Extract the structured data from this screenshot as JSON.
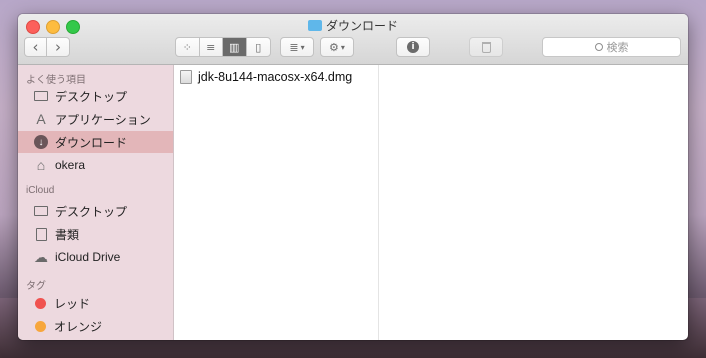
{
  "window": {
    "title": "ダウンロード"
  },
  "toolbar": {
    "back": "‹",
    "forward": "›",
    "view_icons": "⁘",
    "view_list": "≡",
    "view_columns": "▥",
    "view_gallery": "▯",
    "arrange": "≣",
    "action": "⚙",
    "info": "i",
    "trash": "🗑",
    "search_placeholder": "検索"
  },
  "sidebar": {
    "favorites_header": "よく使う項目",
    "favorites": [
      {
        "label": "デスクトップ",
        "icon": "desktop-icon"
      },
      {
        "label": "アプリケーション",
        "icon": "applications-icon"
      },
      {
        "label": "ダウンロード",
        "icon": "downloads-icon",
        "selected": true
      },
      {
        "label": "okera",
        "icon": "home-icon"
      }
    ],
    "icloud_header": "iCloud",
    "icloud": [
      {
        "label": "デスクトップ",
        "icon": "desktop-icon"
      },
      {
        "label": "書類",
        "icon": "documents-icon"
      },
      {
        "label": "iCloud Drive",
        "icon": "cloud-icon"
      }
    ],
    "tags_header": "タグ",
    "tags": [
      {
        "label": "レッド",
        "color": "#f0524f"
      },
      {
        "label": "オレンジ",
        "color": "#f7a63c"
      }
    ]
  },
  "files": [
    {
      "name": "jdk-8u144-macosx-x64.dmg",
      "icon": "dmg-file-icon"
    }
  ]
}
